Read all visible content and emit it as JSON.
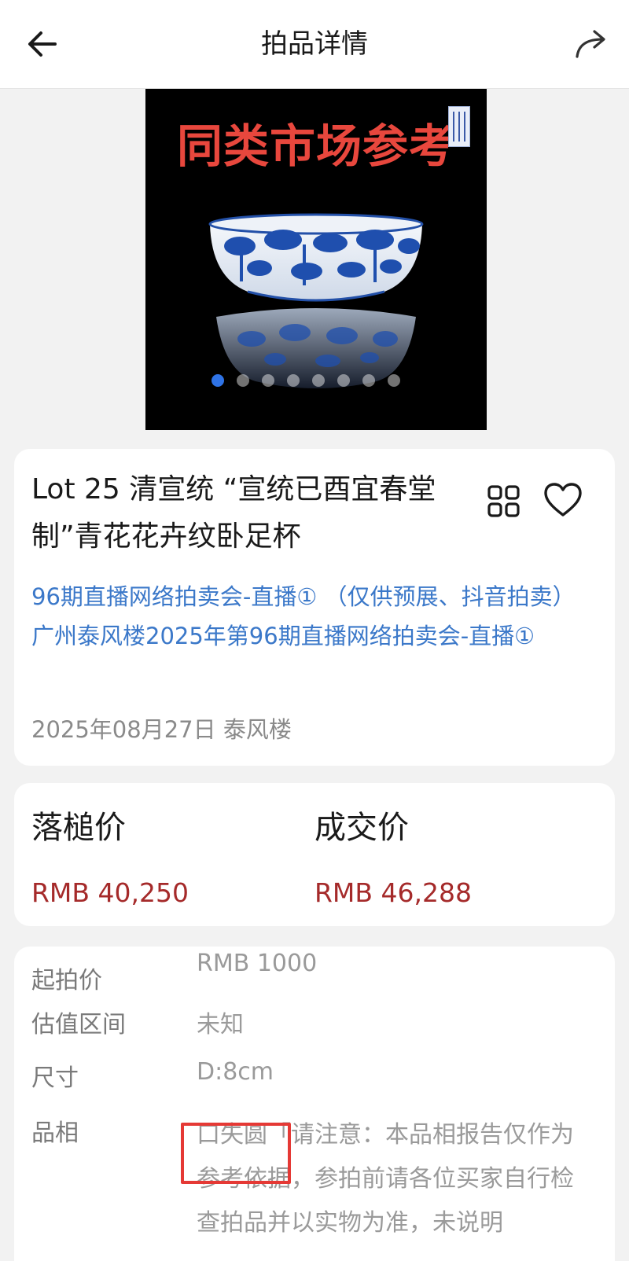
{
  "header": {
    "title": "拍品详情",
    "back_icon": "arrow-left-icon",
    "share_icon": "share-arrow-icon"
  },
  "hero": {
    "banner_text": "同类市场参考",
    "slide_count": 8,
    "active_slide": 1,
    "active_dot_color": "#2f73e6",
    "banner_color": "#e8473d"
  },
  "lot": {
    "title": "Lot 25 清宣统 “宣统已酉宜春堂制”青花花卉纹卧足杯",
    "grid_icon": "grid-icon",
    "favorite_icon": "heart-icon",
    "auction_link": "96期直播网络拍卖会-直播① （仅供预展、抖音拍卖）广州泰风楼2025年第96期直播网络拍卖会-直播①",
    "date_house": "2025年08月27日 泰风楼"
  },
  "prices": {
    "hammer_label": "落槌价",
    "hammer_value": "RMB 40,250",
    "deal_label": "成交价",
    "deal_value": "RMB 46,288",
    "value_color": "#a52a2a"
  },
  "details": {
    "start_label": "起拍价",
    "start_value": "RMB 1000",
    "estimate_label": "估值区间",
    "estimate_value": "未知",
    "size_label": "尺寸",
    "size_value": "D:8cm",
    "condition_label": "品相",
    "condition_text": "口失圆「请注意：本品相报告仅作为参考依据，参拍前请各位买家自行检查拍品并以实物为准，未说明"
  }
}
